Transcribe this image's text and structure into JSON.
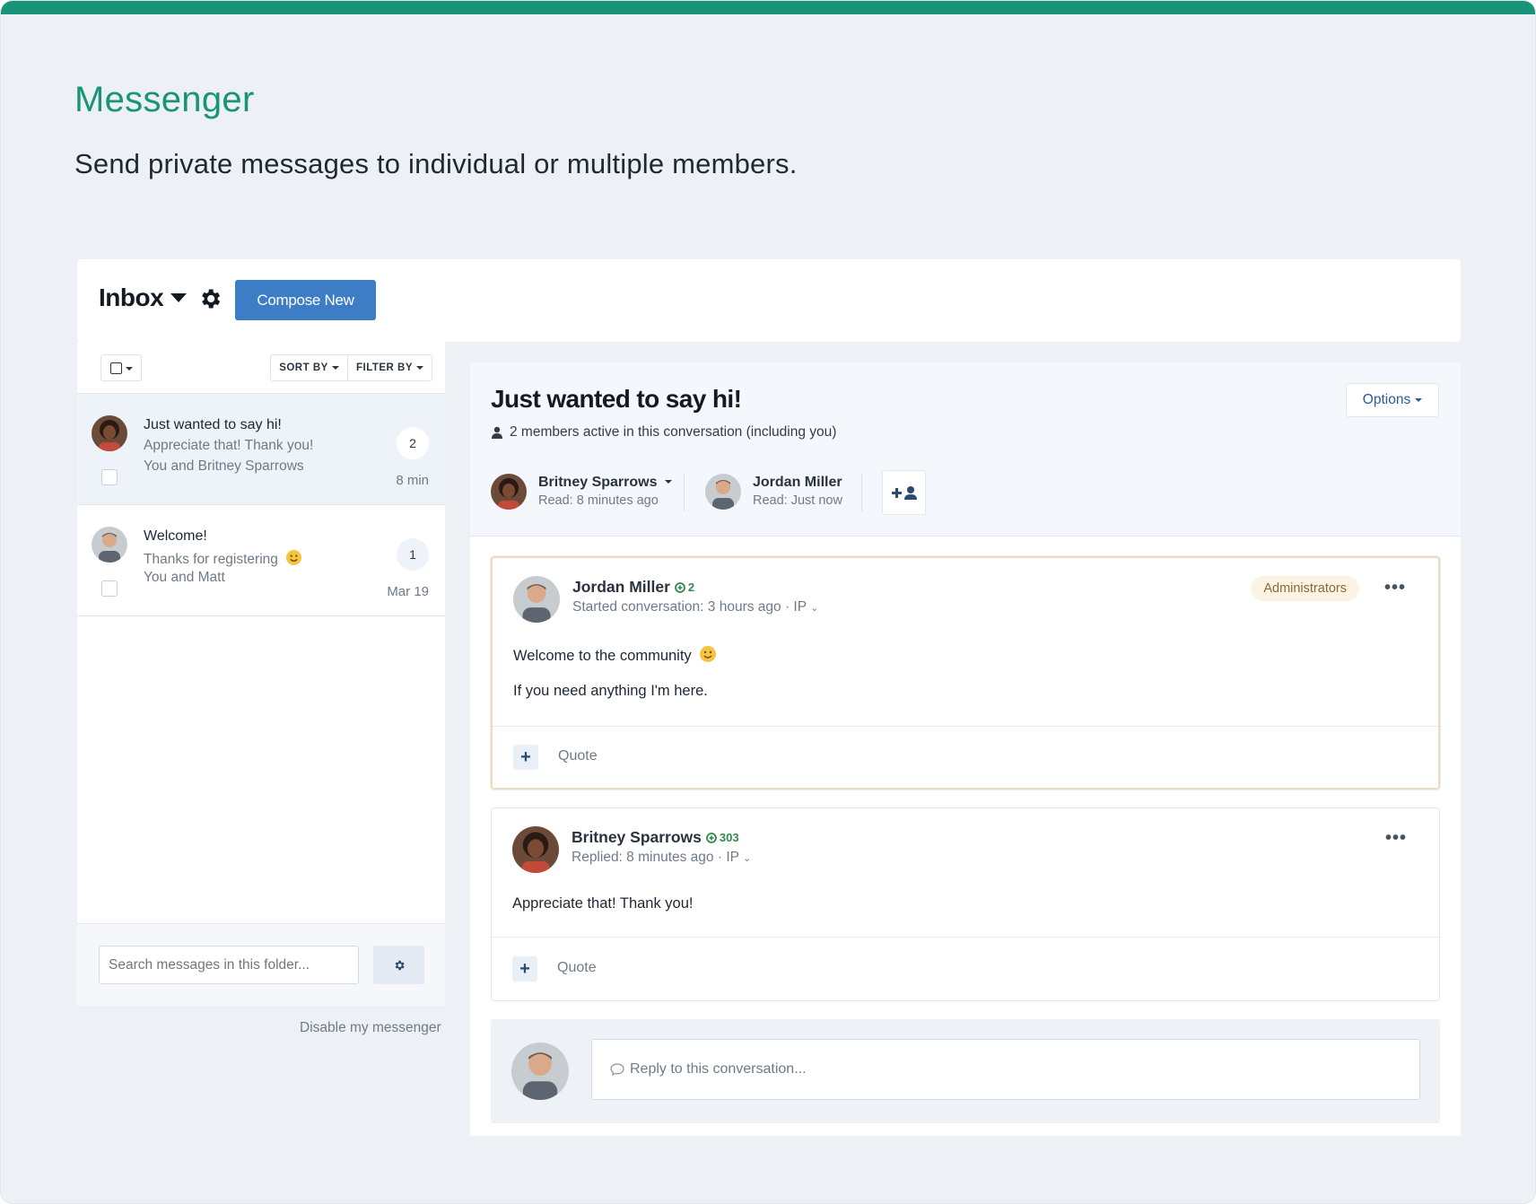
{
  "hero": {
    "title": "Messenger",
    "subtitle": "Send private messages to individual or multiple members."
  },
  "colors": {
    "accent": "#1a9479",
    "primary_button": "#3c7dc6",
    "link": "#2a5b95",
    "reputation": "#2f8a4d",
    "badge_bg": "#fbf3e4"
  },
  "header": {
    "title": "Inbox",
    "settings_icon": "gear-icon",
    "compose_label": "Compose New"
  },
  "list_toolbar": {
    "sort_label": "SORT BY",
    "filter_label": "FILTER BY"
  },
  "conversations": [
    {
      "title": "Just wanted to say hi!",
      "snippet": "Appreciate that! Thank you!",
      "people": "You and Britney Sparrows",
      "count": "2",
      "time": "8 min",
      "active": true
    },
    {
      "title": "Welcome!",
      "snippet": "Thanks for registering",
      "people": "You and Matt",
      "count": "1",
      "time": "Mar 19",
      "active": false
    }
  ],
  "search": {
    "placeholder": "Search messages in this folder..."
  },
  "disable_link": "Disable my messenger",
  "conversation": {
    "title": "Just wanted to say hi!",
    "options_label": "Options",
    "active_members": "2 members active in this conversation (including you)",
    "participants": [
      {
        "name": "Britney Sparrows",
        "read": "Read: 8 minutes ago"
      },
      {
        "name": "Jordan Miller",
        "read": "Read: Just now"
      }
    ],
    "messages": [
      {
        "author": "Jordan Miller",
        "rep": "2",
        "meta": "Started conversation: 3 hours ago · IP",
        "badge": "Administrators",
        "line1": "Welcome to the community",
        "line2": "If you need anything I'm here.",
        "quote": "Quote"
      },
      {
        "author": "Britney Sparrows",
        "rep": "303",
        "meta": "Replied: 8 minutes ago · IP",
        "line1": "Appreciate that! Thank you!",
        "quote": "Quote"
      }
    ],
    "reply_placeholder": "Reply to this conversation..."
  }
}
